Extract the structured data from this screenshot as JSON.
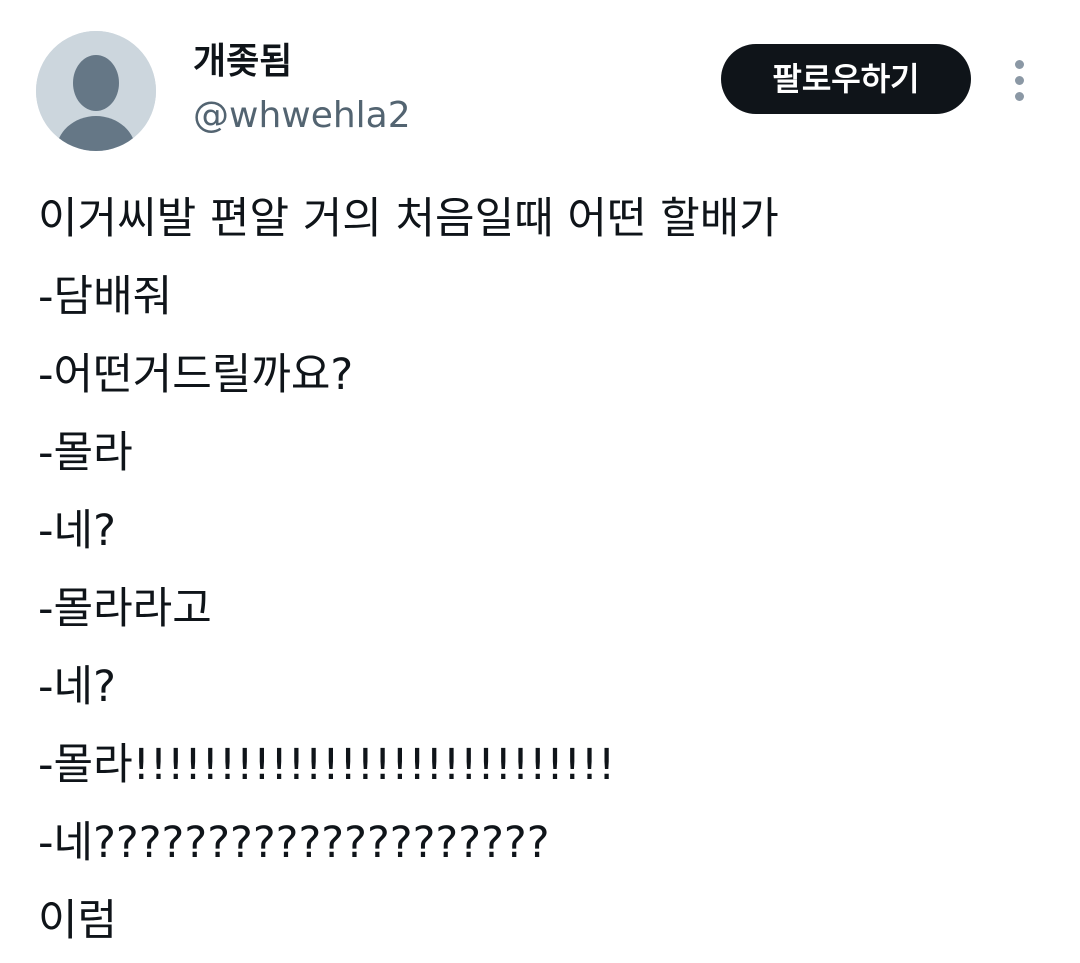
{
  "author": {
    "display_name": "개좆됨",
    "handle": "@whwehla2",
    "avatar_icon": "default-avatar-icon"
  },
  "actions": {
    "follow_label": "팔로우하기",
    "more_icon": "more-vertical-icon"
  },
  "tweet": {
    "lines": [
      "이거씨발 편알 거의 처음일때 어떤 할배가",
      "-담배줘",
      "-어떤거드릴까요?",
      "-몰라",
      "-네?",
      "-몰라라고",
      "-네?",
      "-몰라!!!!!!!!!!!!!!!!!!!!!!!!!!!!",
      "-네????????????????????",
      "이럼"
    ]
  },
  "colors": {
    "text_primary": "#0f1419",
    "text_secondary": "#536471",
    "button_bg": "#0f1419",
    "button_text": "#ffffff",
    "avatar_bg": "#ccd6dd",
    "avatar_figure": "#657786"
  }
}
